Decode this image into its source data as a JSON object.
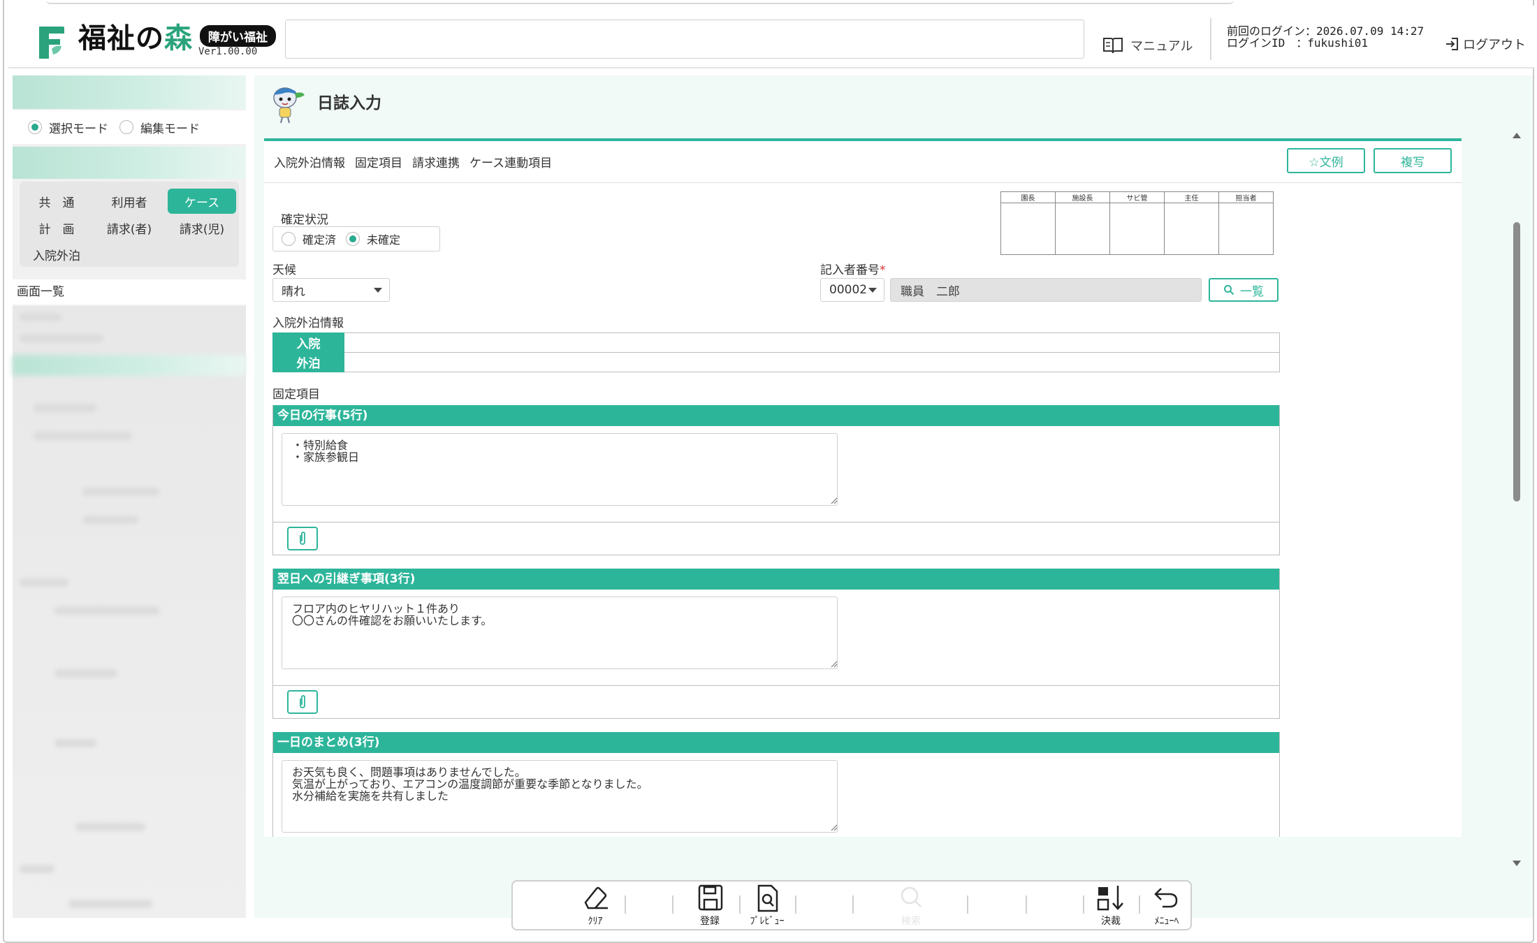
{
  "header": {
    "logo_main": "福祉の",
    "logo_accent": "森",
    "logo_badge": "障がい福祉",
    "version": "Ver1.00.00",
    "manual_label": "マニュアル",
    "last_login": "前回のログイン：2026.07.09 14:27",
    "login_id": "ログインID　：fukushi01",
    "logout_label": "ログアウト"
  },
  "sidebar": {
    "mode_select": "選択モード",
    "mode_edit": "編集モード",
    "selected_mode": "select",
    "categories": [
      "共　通",
      "利用者",
      "ケース",
      "計　画",
      "請求(者)",
      "請求(児)",
      "入院外泊"
    ],
    "active_category": "ケース",
    "screen_list_label": "画面一覧"
  },
  "main": {
    "title": "日誌入力",
    "tabs": [
      "入院外泊情報",
      "固定項目",
      "請求連携",
      "ケース連動項目"
    ],
    "template_button": "☆文例",
    "copy_button": "複写",
    "confirm_status_label": "確定状況",
    "confirm_options": [
      "確定済",
      "未確定"
    ],
    "confirm_selected": "未確定",
    "stamp_headers": [
      "園長",
      "施設長",
      "サビ管",
      "主任",
      "担当者"
    ],
    "weather_label": "天候",
    "weather_value": "晴れ",
    "writer_label": "記入者番号",
    "writer_required_mark": "*",
    "writer_code": "00002",
    "writer_name": "職員　二郎",
    "list_button": "一覧",
    "inout_section_label": "入院外泊情報",
    "inout_rows": [
      "入院",
      "外泊"
    ],
    "fixed_section_label": "固定項目",
    "sections": [
      {
        "title": "今日の行事(5行)",
        "text": "・特別給食\n・家族参観日"
      },
      {
        "title": "翌日への引継ぎ事項(3行)",
        "text": "フロア内のヒヤリハット１件あり\n〇〇さんの件確認をお願いいたします。"
      },
      {
        "title": "一日のまとめ(3行)",
        "text": "お天気も良く、問題事項はありませんでした。\n気温が上がっており、エアコンの温度調節が重要な季節となりました。\n水分補給を実施を共有しました"
      }
    ]
  },
  "toolbar": {
    "clear": "ｸﾘｱ",
    "register": "登録",
    "preview": "ﾌﾟﾚﾋﾞｭｰ",
    "search": "検索",
    "approve": "決裁",
    "menu": "ﾒﾆｭｰﾍ"
  },
  "colors": {
    "accent": "#2db59a",
    "logo_green": "#2aa37c",
    "main_bg": "#f1faf7"
  }
}
